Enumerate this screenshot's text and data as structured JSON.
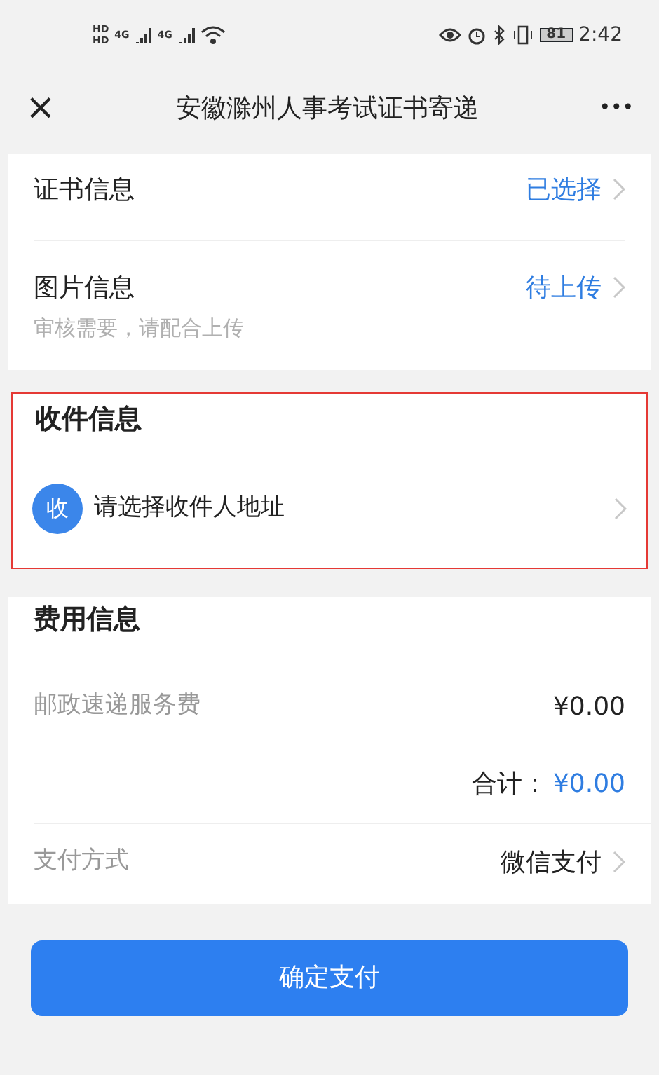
{
  "status_bar": {
    "network_labels": [
      "HD",
      "HD",
      "4G",
      "4G"
    ],
    "battery": "81",
    "time": "2:42"
  },
  "nav": {
    "close": "×",
    "title": "安徽滁州人事考试证书寄递",
    "more": "•••"
  },
  "info_rows": [
    {
      "label": "证书信息",
      "value": "已选择"
    },
    {
      "label": "图片信息",
      "value": "待上传",
      "hint": "审核需要，请配合上传"
    }
  ],
  "recipient": {
    "title": "收件信息",
    "highlighted": true,
    "avatar": "收",
    "prompt": "请选择收件人地址"
  },
  "fees": {
    "title": "费用信息",
    "item_label": "邮政速递服务费",
    "item_amount": "¥0.00",
    "total_label": "合计：",
    "total_amount": "¥0.00",
    "payment_label": "支付方式",
    "payment_value": "微信支付"
  },
  "submit": "确定支付"
}
